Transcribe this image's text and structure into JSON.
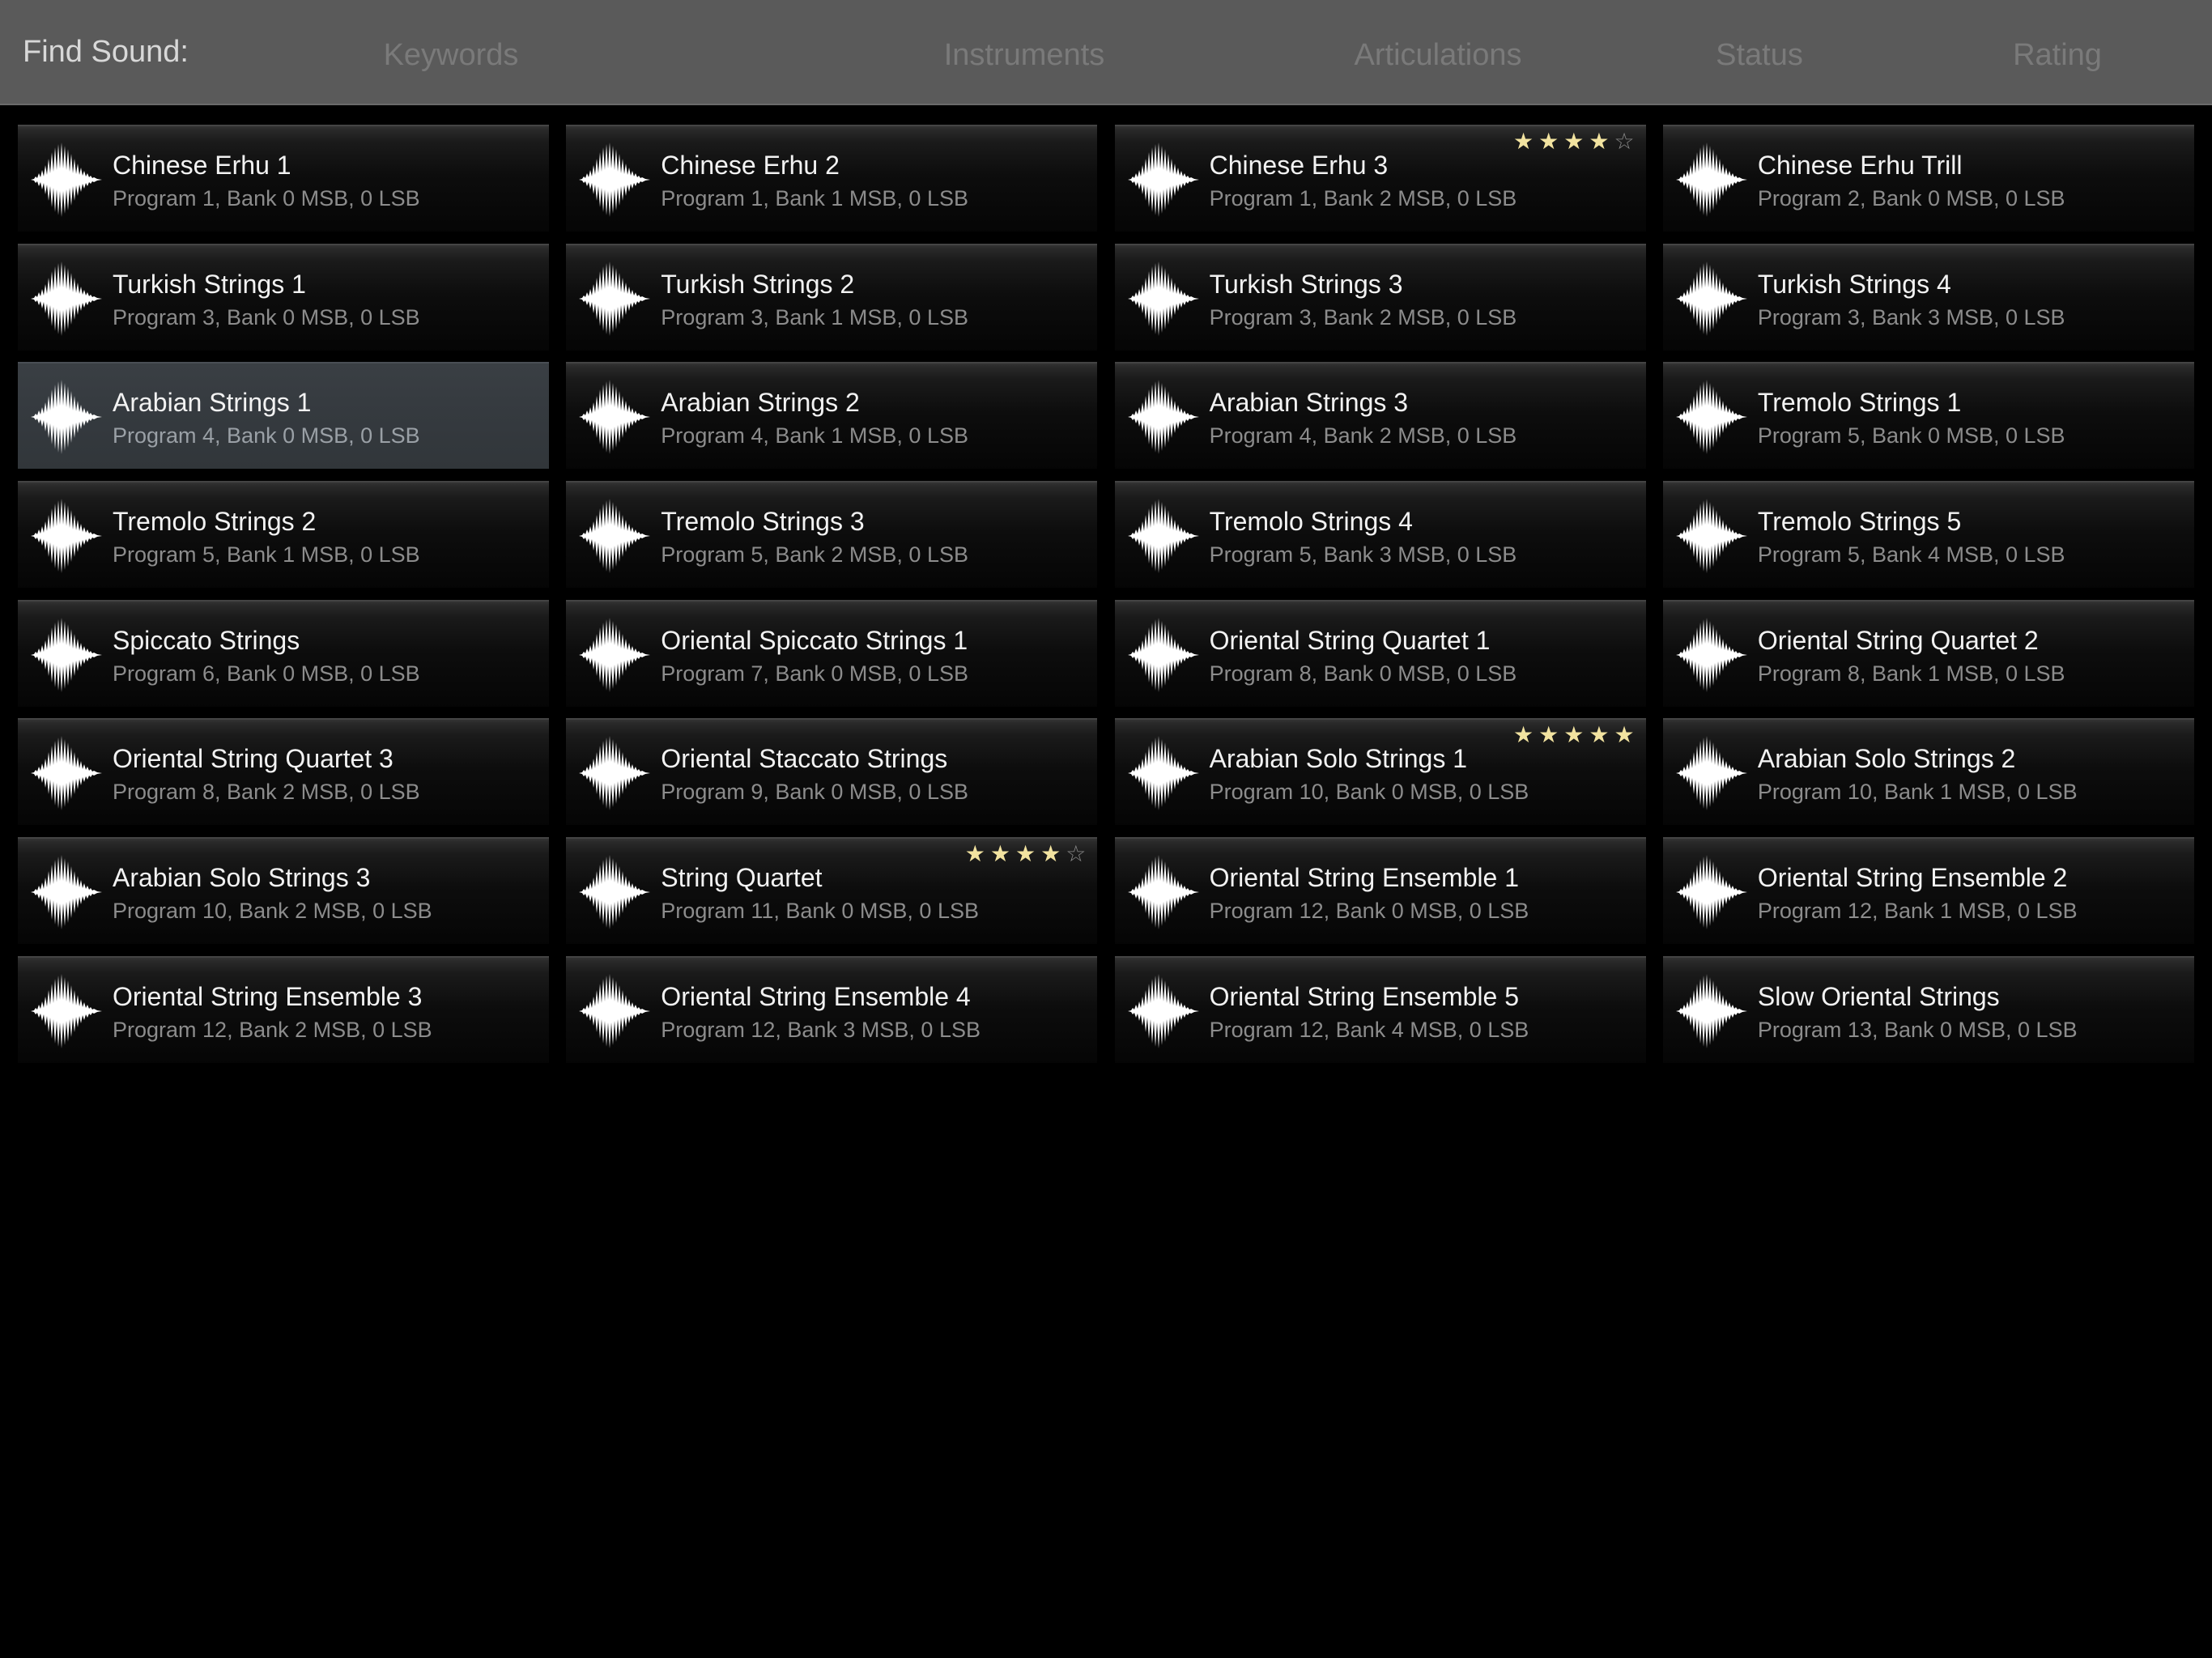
{
  "filter_bar": {
    "find_label": "Find Sound:",
    "tabs": {
      "keywords": "Keywords",
      "instruments": "Instruments",
      "articulations": "Articulations",
      "status": "Status",
      "rating": "Rating"
    }
  },
  "colors": {
    "background": "#000000",
    "filter_bar": "#5a5a5a",
    "selected_tile": "#34393e",
    "star_filled": "#f2e3a0",
    "star_empty": "#8a8a8a"
  },
  "selected_index": 8,
  "sounds": [
    {
      "name": "Chinese Erhu 1",
      "meta": "Program 1, Bank 0 MSB, 0 LSB"
    },
    {
      "name": "Chinese Erhu 2",
      "meta": "Program 1, Bank 1 MSB, 0 LSB"
    },
    {
      "name": "Chinese Erhu 3",
      "meta": "Program 1, Bank 2 MSB, 0 LSB",
      "rating": 4
    },
    {
      "name": "Chinese Erhu Trill",
      "meta": "Program 2, Bank 0 MSB, 0 LSB"
    },
    {
      "name": "Turkish Strings 1",
      "meta": "Program 3, Bank 0 MSB, 0 LSB"
    },
    {
      "name": "Turkish Strings 2",
      "meta": "Program 3, Bank 1 MSB, 0 LSB"
    },
    {
      "name": "Turkish Strings 3",
      "meta": "Program 3, Bank 2 MSB, 0 LSB"
    },
    {
      "name": "Turkish Strings 4",
      "meta": "Program 3, Bank 3 MSB, 0 LSB"
    },
    {
      "name": "Arabian Strings 1",
      "meta": "Program 4, Bank 0 MSB, 0 LSB"
    },
    {
      "name": "Arabian Strings 2",
      "meta": "Program 4, Bank 1 MSB, 0 LSB"
    },
    {
      "name": "Arabian Strings 3",
      "meta": "Program 4, Bank 2 MSB, 0 LSB"
    },
    {
      "name": "Tremolo Strings 1",
      "meta": "Program 5, Bank 0 MSB, 0 LSB"
    },
    {
      "name": "Tremolo Strings 2",
      "meta": "Program 5, Bank 1 MSB, 0 LSB"
    },
    {
      "name": "Tremolo Strings 3",
      "meta": "Program 5, Bank 2 MSB, 0 LSB"
    },
    {
      "name": "Tremolo Strings 4",
      "meta": "Program 5, Bank 3 MSB, 0 LSB"
    },
    {
      "name": "Tremolo Strings 5",
      "meta": "Program 5, Bank 4 MSB, 0 LSB"
    },
    {
      "name": "Spiccato Strings",
      "meta": "Program 6, Bank 0 MSB, 0 LSB"
    },
    {
      "name": "Oriental Spiccato Strings 1",
      "meta": "Program 7, Bank 0 MSB, 0 LSB"
    },
    {
      "name": "Oriental String Quartet 1",
      "meta": "Program 8, Bank 0 MSB, 0 LSB"
    },
    {
      "name": "Oriental String Quartet 2",
      "meta": "Program 8, Bank 1 MSB, 0 LSB"
    },
    {
      "name": "Oriental String Quartet 3",
      "meta": "Program 8, Bank 2 MSB, 0 LSB"
    },
    {
      "name": "Oriental Staccato Strings",
      "meta": "Program 9, Bank 0 MSB, 0 LSB"
    },
    {
      "name": "Arabian Solo Strings 1",
      "meta": "Program 10, Bank 0 MSB, 0 LSB",
      "rating": 5
    },
    {
      "name": "Arabian Solo Strings 2",
      "meta": "Program 10, Bank 1 MSB, 0 LSB"
    },
    {
      "name": "Arabian Solo Strings 3",
      "meta": "Program 10, Bank 2 MSB, 0 LSB"
    },
    {
      "name": "String Quartet",
      "meta": "Program 11, Bank 0 MSB, 0 LSB",
      "rating": 4
    },
    {
      "name": "Oriental String Ensemble 1",
      "meta": "Program 12, Bank 0 MSB, 0 LSB"
    },
    {
      "name": "Oriental String Ensemble 2",
      "meta": "Program 12, Bank 1 MSB, 0 LSB"
    },
    {
      "name": "Oriental String Ensemble 3",
      "meta": "Program 12, Bank 2 MSB, 0 LSB"
    },
    {
      "name": "Oriental String Ensemble 4",
      "meta": "Program 12, Bank 3 MSB, 0 LSB"
    },
    {
      "name": "Oriental String Ensemble 5",
      "meta": "Program 12, Bank 4 MSB, 0 LSB"
    },
    {
      "name": "Slow Oriental Strings",
      "meta": "Program 13, Bank 0 MSB, 0 LSB"
    }
  ]
}
